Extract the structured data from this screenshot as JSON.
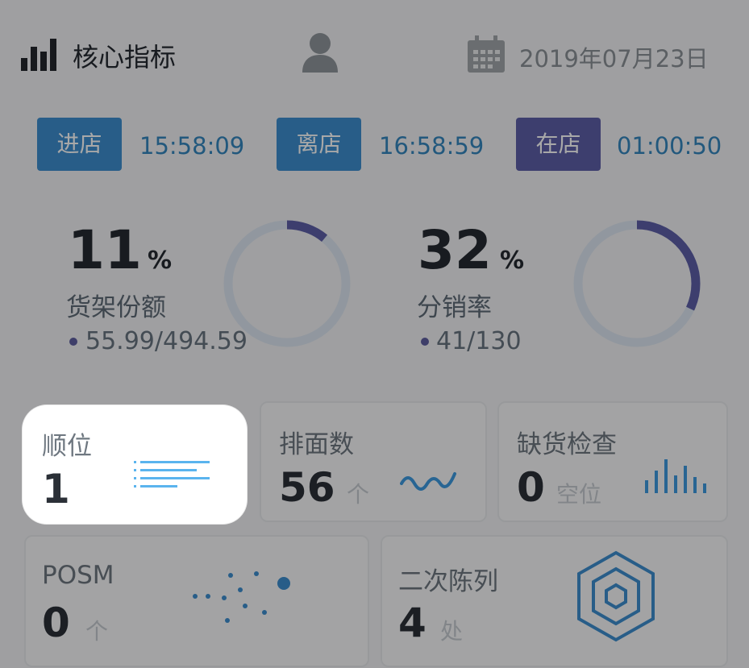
{
  "header": {
    "title": "核心指标",
    "date": "2019年07月23日"
  },
  "times": [
    {
      "label": "进店",
      "value": "15:58:09",
      "color": "#3d8ecf"
    },
    {
      "label": "离店",
      "value": "16:58:59",
      "color": "#3d8ecf"
    },
    {
      "label": "在店",
      "value": "01:00:50",
      "color": "#5d5ea7"
    }
  ],
  "metrics": [
    {
      "value": "11",
      "unit": "%",
      "label": "货架份额",
      "ratio": "55.99/494.59",
      "percent": 11
    },
    {
      "value": "32",
      "unit": "%",
      "label": "分销率",
      "ratio": "41/130",
      "percent": 32
    }
  ],
  "cards": {
    "rank": {
      "label": "顺位",
      "value": "1"
    },
    "facings": {
      "label": "排面数",
      "value": "56",
      "trend": "个"
    },
    "oos": {
      "label": "缺货检查",
      "value": "0",
      "unit": "空位"
    },
    "posm": {
      "label": "POSM",
      "value": "0",
      "trend": "个"
    },
    "secondary": {
      "label": "二次陈列",
      "value": "4",
      "unit": "处"
    }
  },
  "colors": {
    "accent_blue": "#3d8ecf",
    "accent_purple": "#5d5ea7",
    "ring_track": "#dde6f1"
  },
  "icons": {
    "header": "bar-chart-icon",
    "user": "user-icon",
    "calendar": "calendar-icon"
  }
}
